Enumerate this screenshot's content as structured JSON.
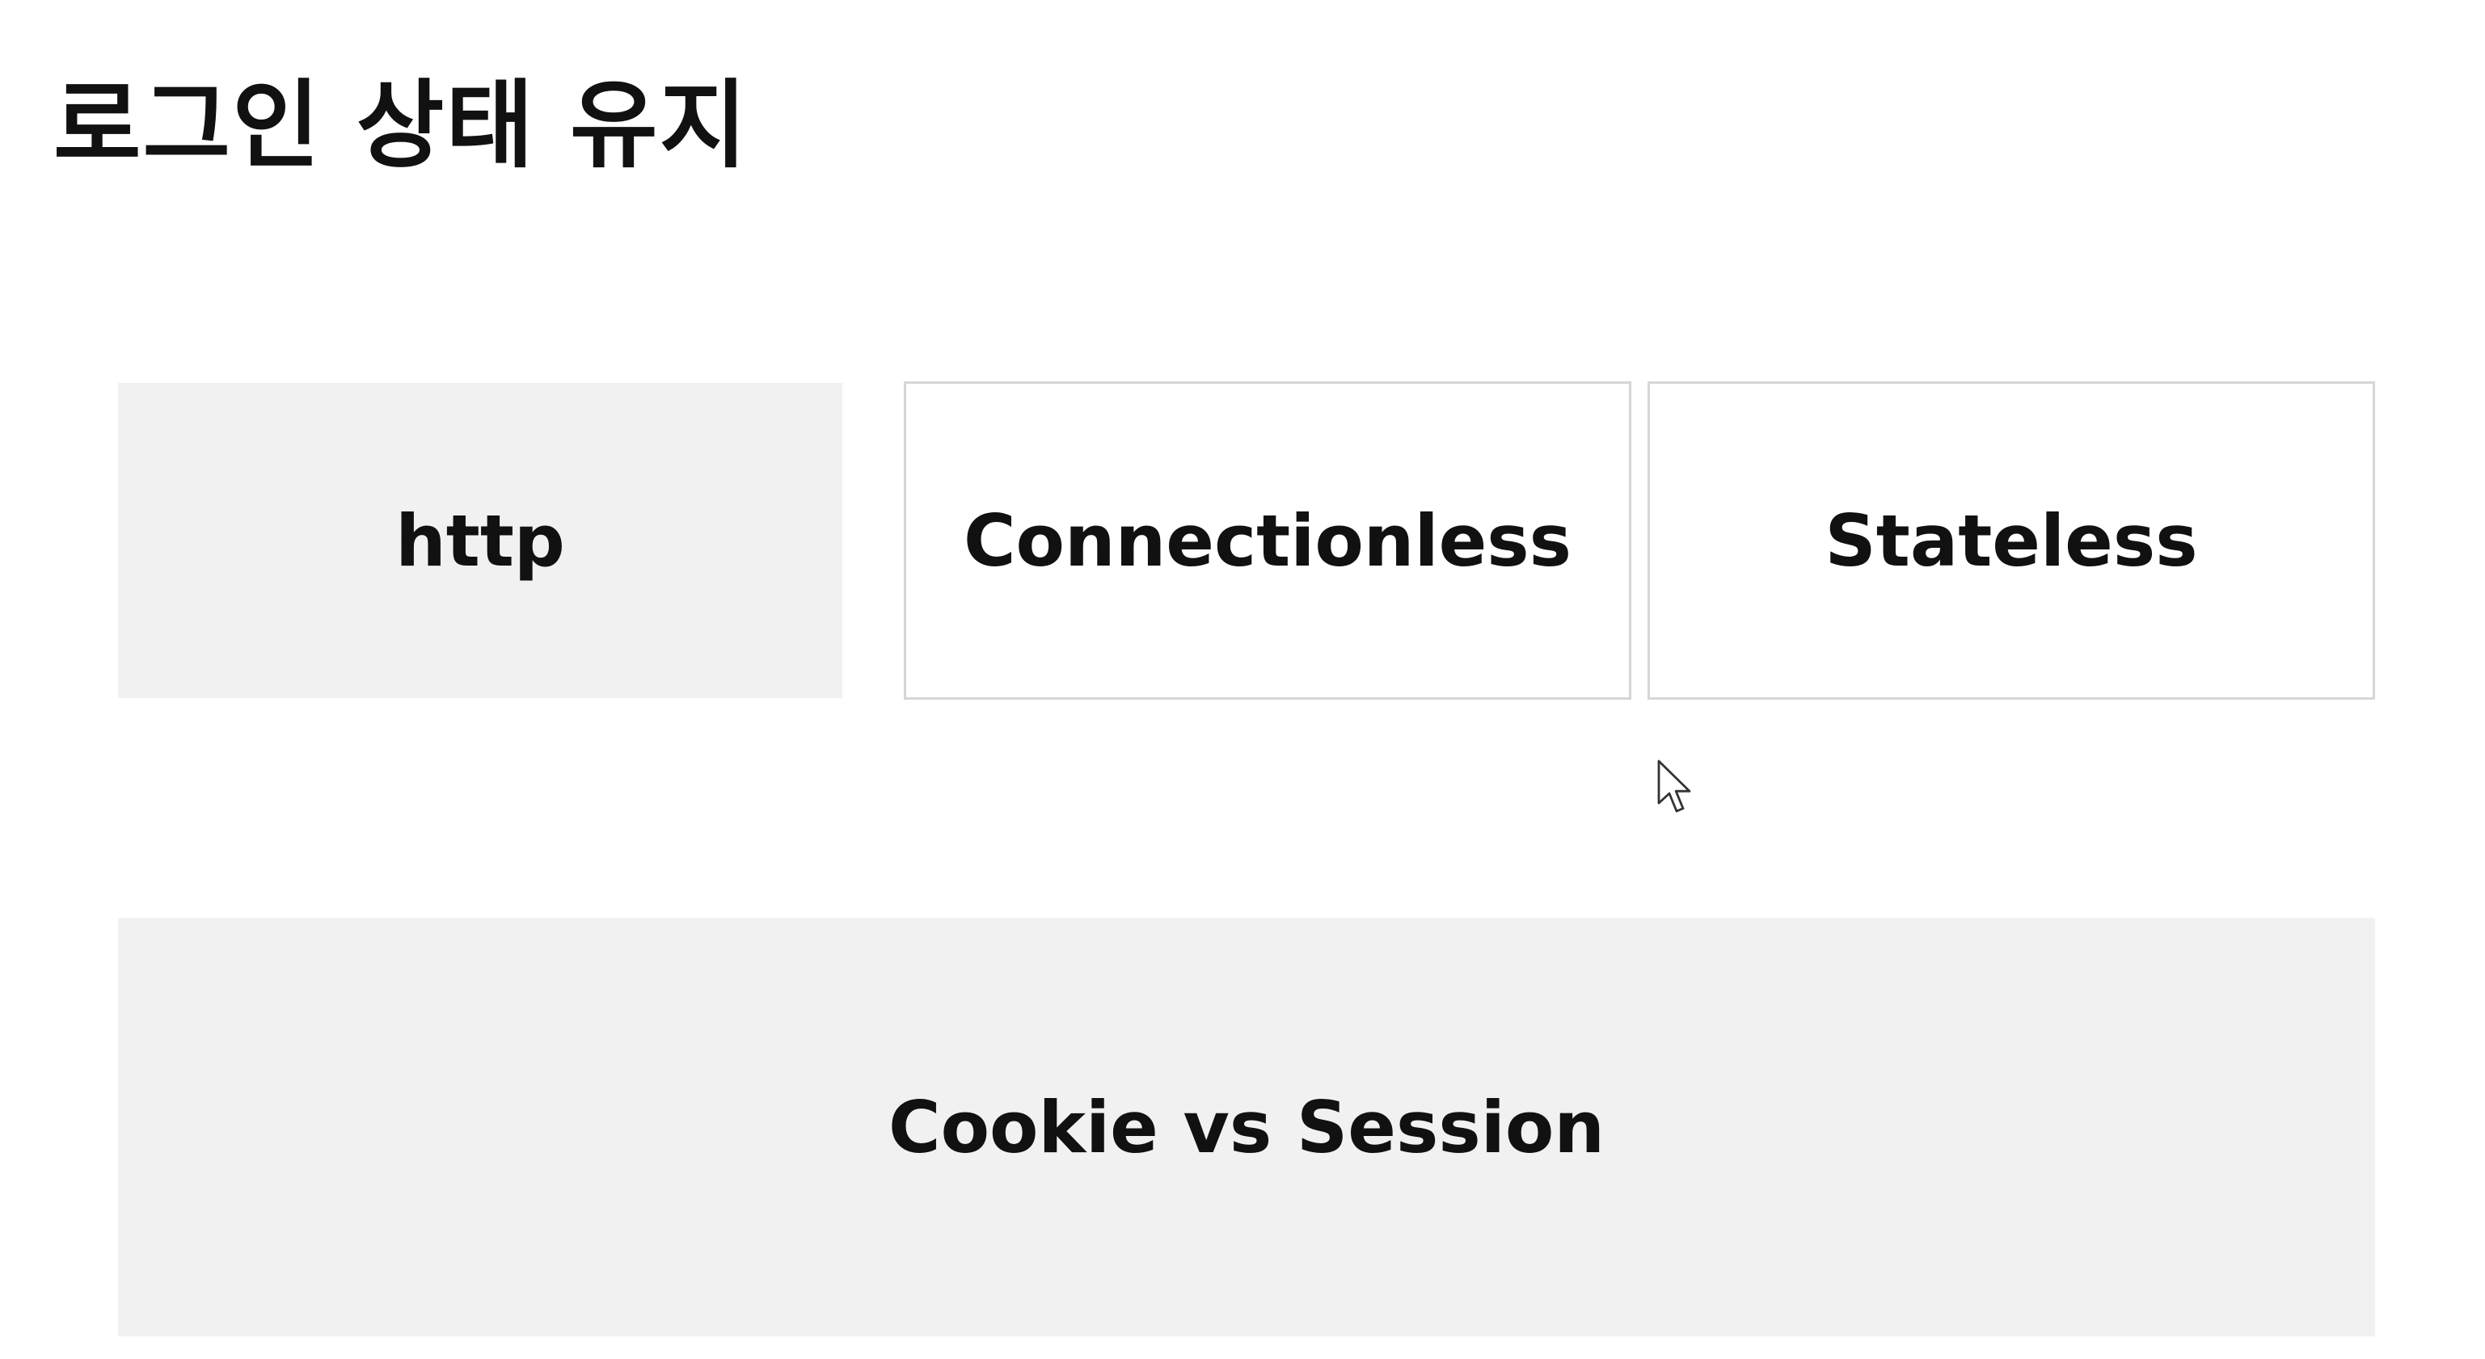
{
  "title": "로그인 상태 유지",
  "top_row": {
    "http_label": "http",
    "connectionless_label": "Connectionless",
    "stateless_label": "Stateless"
  },
  "bottom": {
    "cookie_session_label": "Cookie vs Session"
  },
  "colors": {
    "filled_box": "#f1f1f1",
    "outline_box_border": "#d6d6d6",
    "text": "#111111"
  },
  "icons": {
    "cursor": "mouse-pointer-icon"
  }
}
